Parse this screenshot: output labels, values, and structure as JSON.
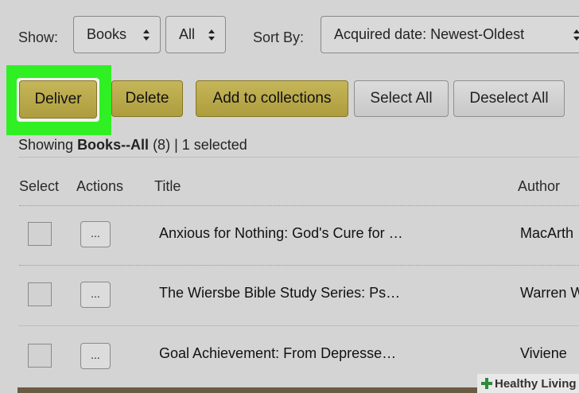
{
  "filters": {
    "show_label": "Show:",
    "type_value": "Books",
    "subset_value": "All",
    "sort_label": "Sort By:",
    "sort_value": "Acquired date: Newest-Oldest"
  },
  "toolbar": {
    "deliver_label": "Deliver",
    "delete_label": "Delete",
    "add_collections_label": "Add to collections",
    "select_all_label": "Select All",
    "deselect_all_label": "Deselect All"
  },
  "summary": {
    "prefix": "Showing ",
    "category": "Books--All",
    "count": " (8)",
    "separator": " | ",
    "selected": "1 selected"
  },
  "columns": {
    "select": "Select",
    "actions": "Actions",
    "title": "Title",
    "author": "Author"
  },
  "rows": [
    {
      "title": "Anxious for Nothing: God's Cure for …",
      "author": "MacArth",
      "actions_label": "..."
    },
    {
      "title": "The Wiersbe Bible Study Series: Ps…",
      "author": "Warren W",
      "actions_label": "..."
    },
    {
      "title": "Goal Achievement: From Depresse…",
      "author": "Viviene",
      "actions_label": "..."
    }
  ],
  "watermark": {
    "text": "Healthy Living",
    "color": "#2e8b3a"
  },
  "colors": {
    "highlight": "#30f024",
    "button_gold": "#b8a84a"
  }
}
